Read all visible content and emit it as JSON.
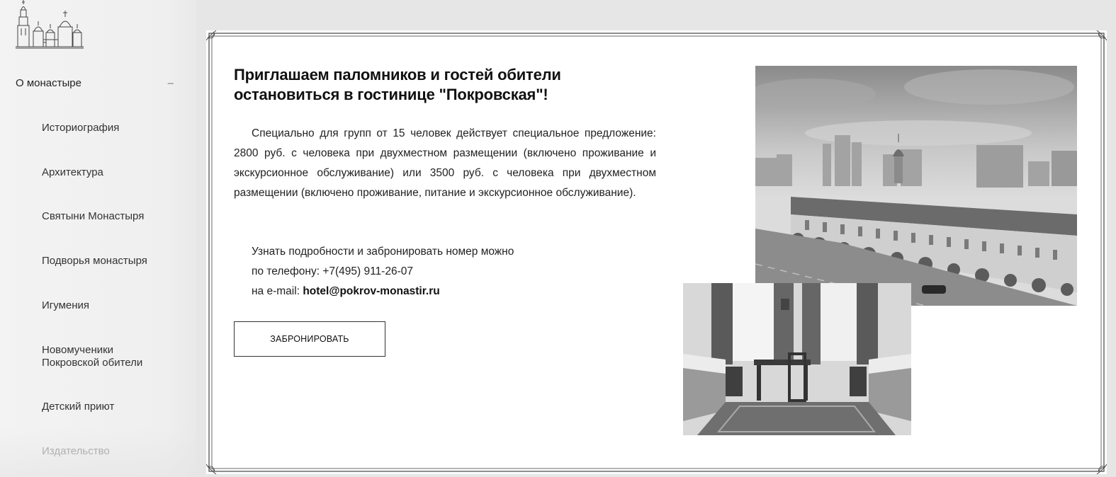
{
  "sidebar": {
    "parent_label": "О монастыре",
    "parent_toggle": "–",
    "items": [
      {
        "label": "Историография"
      },
      {
        "label": "Архитектура"
      },
      {
        "label": "Святыни Монастыря"
      },
      {
        "label": "Подворья монастыря"
      },
      {
        "label": "Игумения"
      },
      {
        "label": "Новомученики Покровской обители"
      },
      {
        "label": "Детский приют"
      },
      {
        "label": "Издательство"
      }
    ]
  },
  "main": {
    "heading": "Приглашаем паломников и гостей обители остановиться в гостинице \"Покровская\"!",
    "paragraph": "Специально для групп от 15 человек действует специальное предложение: 2800 руб. с человека при двухместном размещении (включено проживание и экскурсионное обслуживание) или 3500 руб. с человека при двухместном размещении (включено проживание, питание и экскурсионное обслуживание).",
    "contact_intro": "Узнать подробности и забронировать номер можно",
    "phone_prefix": "по телефону: ",
    "phone": "+7(495) 911-26-07",
    "email_prefix": "на e-mail: ",
    "email": "hotel@pokrov-monastir.ru",
    "book_button": "ЗАБРОНИРОВАТЬ"
  },
  "colors": {
    "page_bg": "#e6e6e6",
    "sidebar_bg": "#f1f1f1",
    "frame_bg": "#ffffff",
    "text": "#1a1a1a"
  }
}
